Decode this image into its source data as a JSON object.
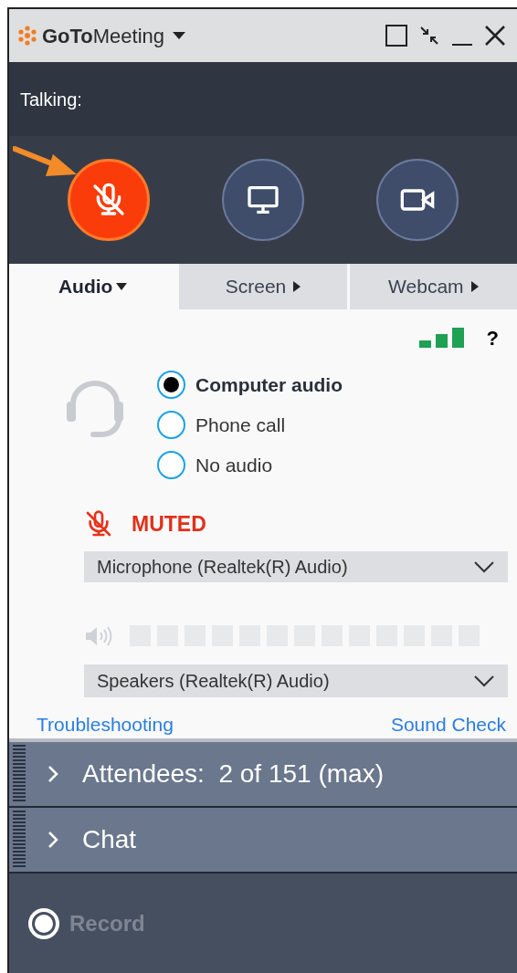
{
  "window": {
    "title": "**GoTo**Meeting"
  },
  "talking": {
    "label": "Talking:"
  },
  "controls": [
    {
      "kind": "mic",
      "muted": true
    },
    {
      "kind": "screen",
      "muted": false
    },
    {
      "kind": "webcam",
      "muted": false
    }
  ],
  "tabs": [
    {
      "label": "Audio",
      "selected": true
    },
    {
      "label": "Screen",
      "selected": false
    },
    {
      "label": "Webcam",
      "selected": false
    }
  ],
  "help": "?",
  "audio_options": [
    {
      "label": "Computer audio",
      "selected": true
    },
    {
      "label": "Phone call",
      "selected": false
    },
    {
      "label": "No audio",
      "selected": false
    }
  ],
  "mic_status": {
    "label": "MUTED",
    "muted": true
  },
  "microphone": {
    "value": "Microphone (Realtek(R) Audio)"
  },
  "speaker_meter": {
    "level": 0
  },
  "speakers": {
    "value": "Speakers (Realtek(R) Audio)"
  },
  "links": [
    "Troubleshooting",
    "Sound Check"
  ],
  "panels": [
    {
      "label": "Attendees:  2 of 151 (max)",
      "expanded": false
    },
    {
      "label": "Chat",
      "expanded": false
    }
  ],
  "record": {
    "label": "Record",
    "disabled": true
  }
}
